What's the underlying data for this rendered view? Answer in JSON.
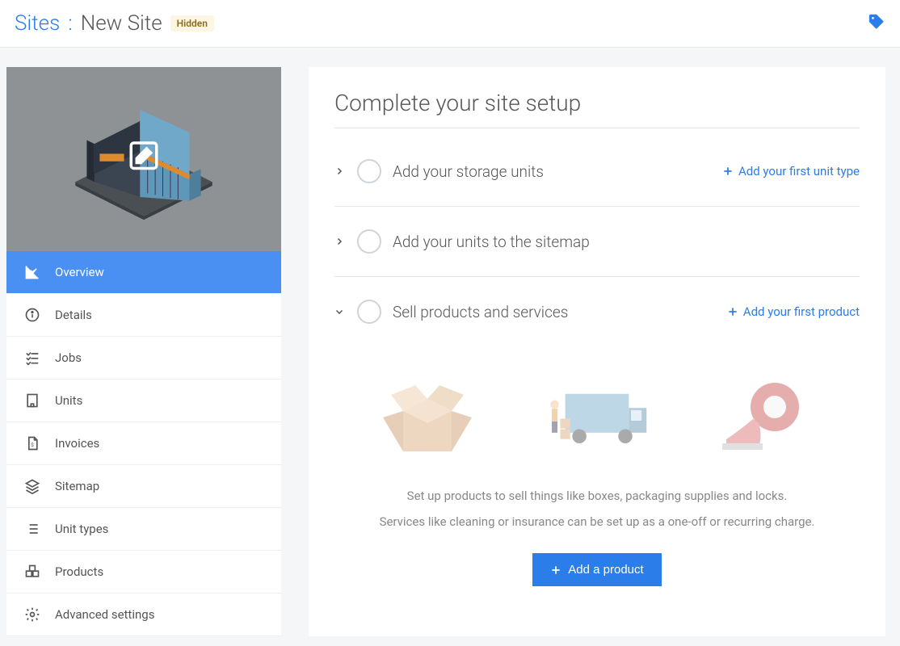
{
  "header": {
    "breadcrumb_root": "Sites",
    "breadcrumb_sep": ":",
    "breadcrumb_current": "New Site",
    "status_badge": "Hidden"
  },
  "sidebar": {
    "items": [
      {
        "label": "Overview",
        "active": true
      },
      {
        "label": "Details"
      },
      {
        "label": "Jobs"
      },
      {
        "label": "Units"
      },
      {
        "label": "Invoices"
      },
      {
        "label": "Sitemap"
      },
      {
        "label": "Unit types"
      },
      {
        "label": "Products"
      },
      {
        "label": "Advanced settings"
      }
    ]
  },
  "main": {
    "title": "Complete your site setup",
    "tasks": [
      {
        "label": "Add your storage units",
        "action": "Add your first unit type",
        "expanded": false
      },
      {
        "label": "Add your units to the sitemap",
        "action": "",
        "expanded": false
      },
      {
        "label": "Sell products and services",
        "action": "Add your first product",
        "expanded": true
      }
    ],
    "products_desc_1": "Set up products to sell things like boxes, packaging supplies and locks.",
    "products_desc_2": "Services like cleaning or insurance can be set up as a one-off or recurring charge.",
    "add_product_btn": "Add a product"
  }
}
